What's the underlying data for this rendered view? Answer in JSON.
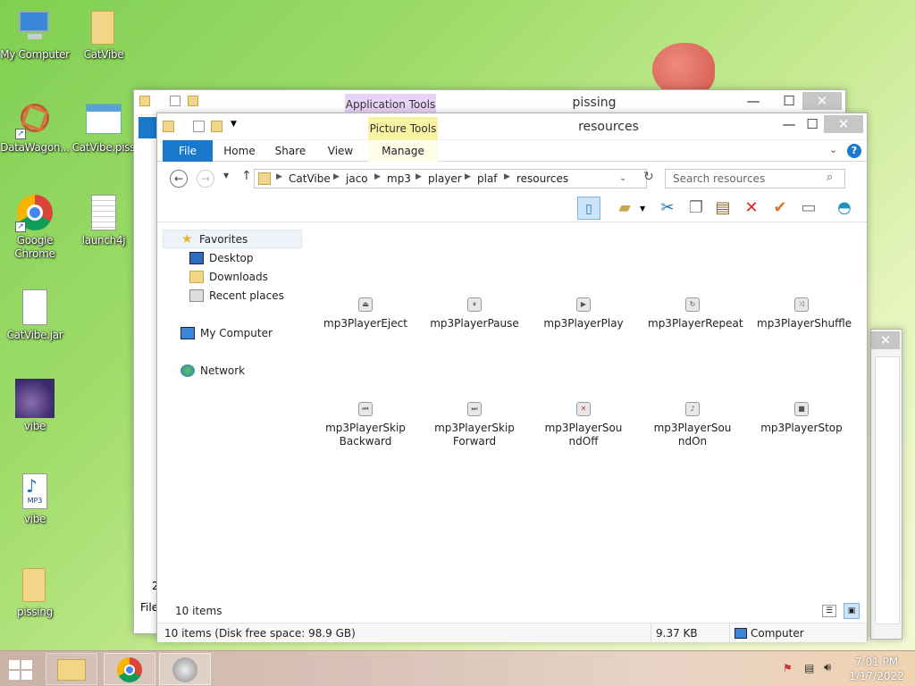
{
  "desktop": {
    "icons": [
      {
        "label": "My Computer",
        "icon": "my-computer-icon"
      },
      {
        "label": "CatVibe",
        "icon": "folder-icon"
      },
      {
        "label": "DataWagon...",
        "icon": "datawagon-icon"
      },
      {
        "label": "CatVibe.piss",
        "icon": "app-icon"
      },
      {
        "label": "Google Chrome",
        "icon": "chrome-icon"
      },
      {
        "label": "launch4j",
        "icon": "document-icon"
      },
      {
        "label": "CatVibe.jar",
        "icon": "document-icon"
      },
      {
        "label": "vibe",
        "icon": "image-icon"
      },
      {
        "label": "vibe",
        "icon": "mp3-icon"
      },
      {
        "label": "pissing",
        "icon": "folder-icon"
      }
    ],
    "mp3_badge": "MP3"
  },
  "back_window": {
    "title": "pissing",
    "context_tab": "Application Tools",
    "partial_status": "File",
    "partial_status2": "2"
  },
  "window": {
    "title": "resources",
    "context_tab": "Picture Tools",
    "tabs": [
      "File",
      "Home",
      "Share",
      "View",
      "Manage"
    ],
    "breadcrumb": [
      "CatVibe",
      "jaco",
      "mp3",
      "player",
      "plaf",
      "resources"
    ],
    "search_placeholder": "Search resources",
    "nav": {
      "favorites": "Favorites",
      "desktop": "Desktop",
      "downloads": "Downloads",
      "recent": "Recent places",
      "my_computer": "My Computer",
      "network": "Network"
    },
    "files": [
      "mp3PlayerEject",
      "mp3PlayerPause",
      "mp3PlayerPlay",
      "mp3PlayerRepeat",
      "mp3PlayerShuffle",
      "mp3PlayerSkipBackward",
      "mp3PlayerSkipForward",
      "mp3PlayerSoundOff",
      "mp3PlayerSoundOn",
      "mp3PlayerStop"
    ],
    "file_glyphs": [
      "⏏",
      "⏸",
      "▶",
      "↻",
      "⤨",
      "⏮",
      "⏭",
      "✕",
      "♪",
      "■"
    ],
    "item_count": "10 items",
    "status_left": "10 items (Disk free space: 98.9 GB)",
    "status_size": "9.37 KB",
    "status_location": "Computer"
  },
  "taskbar": {
    "time": "7:01 PM",
    "date": "1/17/2022"
  },
  "colors": {
    "file_tab": "#1979ca",
    "application_tools": "#e9d3f6",
    "picture_tools": "#f7f3a2",
    "close_button": "#c6c6c6"
  }
}
